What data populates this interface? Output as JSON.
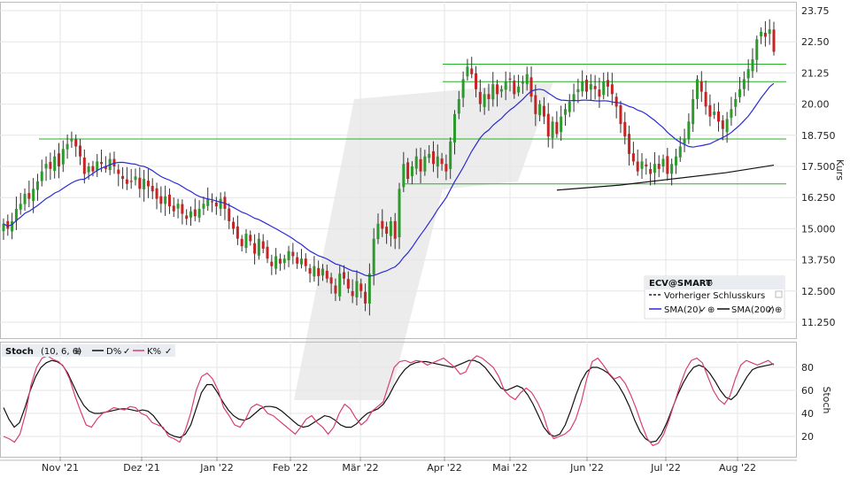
{
  "chart_data": [
    {
      "type": "candlestick",
      "panel": "price",
      "ylabel": "Kurs",
      "ylim": [
        10.5,
        24.0
      ],
      "yticks": [
        "23.75",
        "22.50",
        "21.25",
        "20.00",
        "18.750",
        "17.500",
        "16.250",
        "15.000",
        "13.750",
        "12.500",
        "11.250"
      ],
      "months": [
        "Nov '21",
        "Dez '21",
        "Jan '22",
        "Feb '22",
        "Mär '22",
        "Apr '22",
        "Mai '22",
        "Jun '22",
        "Jul '22",
        "Aug '22"
      ],
      "closes": [
        15.2,
        15.0,
        15.3,
        15.8,
        16.0,
        16.4,
        16.2,
        16.6,
        16.9,
        17.3,
        17.6,
        17.4,
        17.9,
        17.5,
        18.2,
        18.4,
        18.6,
        18.3,
        17.9,
        17.2,
        17.5,
        17.3,
        17.7,
        17.6,
        17.4,
        17.8,
        17.5,
        17.2,
        17.0,
        16.8,
        16.9,
        17.1,
        16.6,
        17.0,
        16.7,
        16.5,
        16.2,
        16.0,
        16.3,
        15.9,
        15.7,
        16.0,
        15.6,
        15.4,
        15.7,
        15.5,
        15.8,
        16.0,
        16.2,
        16.1,
        15.9,
        16.2,
        15.8,
        15.3,
        15.0,
        14.6,
        14.3,
        14.8,
        14.5,
        14.0,
        14.6,
        14.2,
        13.8,
        13.5,
        13.9,
        13.6,
        13.8,
        14.1,
        13.9,
        13.6,
        13.8,
        13.5,
        13.2,
        13.5,
        13.1,
        13.4,
        13.0,
        12.8,
        12.4,
        13.2,
        13.0,
        12.6,
        12.3,
        12.9,
        12.5,
        12.0,
        13.2,
        14.6,
        15.2,
        15.0,
        14.8,
        15.3,
        14.6,
        16.6,
        17.6,
        17.0,
        17.5,
        17.9,
        17.3,
        17.9,
        18.0,
        17.6,
        17.9,
        17.6,
        17.3,
        18.5,
        19.6,
        20.2,
        21.0,
        21.5,
        21.2,
        20.6,
        20.0,
        20.4,
        20.2,
        20.8,
        20.4,
        20.6,
        20.9,
        21.0,
        20.4,
        20.7,
        20.9,
        21.2,
        20.3,
        19.6,
        20.0,
        19.5,
        18.7,
        19.3,
        18.8,
        19.5,
        19.8,
        20.1,
        20.4,
        20.6,
        20.9,
        20.5,
        20.8,
        20.6,
        20.3,
        20.9,
        20.7,
        20.4,
        19.9,
        19.2,
        18.7,
        18.0,
        17.7,
        17.3,
        17.7,
        17.5,
        17.2,
        17.6,
        17.4,
        17.8,
        17.2,
        17.6,
        17.9,
        18.3,
        18.6,
        19.3,
        20.2,
        21.0,
        20.5,
        19.9,
        19.5,
        19.7,
        19.3,
        19.0,
        19.4,
        19.8,
        20.2,
        20.6,
        21.0,
        21.4,
        21.8,
        22.6,
        22.9,
        22.7,
        23.0,
        22.1
      ],
      "series": [
        {
          "name": "SMA(20)",
          "color": "#2b2bd6"
        },
        {
          "name": "SMA(200)",
          "color": "#111111"
        }
      ],
      "horizontal_lines": [
        21.6,
        20.9,
        18.6,
        16.8
      ],
      "hline_color": "#28b028"
    },
    {
      "type": "line",
      "panel": "stochastic",
      "ylabel": "Stoch",
      "ylim": [
        0,
        100
      ],
      "yticks": [
        "80",
        "60",
        "40",
        "20"
      ],
      "params": "(10, 6, 6)",
      "series": [
        {
          "name": "D%",
          "color": "#111111",
          "values": [
            45,
            35,
            28,
            32,
            45,
            60,
            72,
            80,
            84,
            86,
            85,
            82,
            75,
            65,
            55,
            47,
            42,
            40,
            40,
            41,
            42,
            43,
            44,
            44,
            43,
            42,
            43,
            42,
            38,
            32,
            26,
            22,
            20,
            19,
            22,
            30,
            44,
            58,
            65,
            65,
            58,
            50,
            43,
            38,
            35,
            34,
            36,
            40,
            44,
            46,
            46,
            45,
            42,
            38,
            34,
            30,
            28,
            29,
            32,
            35,
            38,
            37,
            34,
            30,
            28,
            28,
            31,
            36,
            40,
            42,
            44,
            48,
            55,
            64,
            72,
            78,
            82,
            84,
            85,
            85,
            84,
            83,
            82,
            81,
            80,
            82,
            84,
            86,
            86,
            84,
            80,
            74,
            68,
            62,
            60,
            62,
            64,
            62,
            56,
            48,
            38,
            28,
            22,
            20,
            22,
            30,
            42,
            56,
            68,
            76,
            80,
            80,
            78,
            75,
            70,
            64,
            56,
            46,
            34,
            24,
            18,
            15,
            16,
            22,
            32,
            44,
            56,
            66,
            74,
            80,
            82,
            80,
            75,
            68,
            60,
            54,
            52,
            56,
            64,
            72,
            78,
            80,
            81,
            82,
            83
          ]
        },
        {
          "name": "K%",
          "color": "#d8406c",
          "values": [
            20,
            18,
            15,
            22,
            40,
            65,
            80,
            88,
            90,
            87,
            85,
            80,
            70,
            55,
            42,
            30,
            28,
            35,
            40,
            42,
            45,
            44,
            43,
            46,
            45,
            40,
            38,
            32,
            30,
            28,
            20,
            18,
            15,
            25,
            40,
            60,
            72,
            75,
            70,
            60,
            45,
            38,
            30,
            28,
            35,
            45,
            48,
            46,
            40,
            38,
            34,
            30,
            26,
            22,
            28,
            35,
            38,
            32,
            28,
            22,
            28,
            40,
            48,
            44,
            36,
            30,
            34,
            42,
            46,
            50,
            65,
            80,
            85,
            86,
            84,
            86,
            85,
            82,
            84,
            86,
            88,
            84,
            80,
            74,
            76,
            86,
            90,
            88,
            84,
            80,
            72,
            60,
            55,
            52,
            58,
            62,
            58,
            50,
            40,
            25,
            18,
            20,
            22,
            26,
            35,
            50,
            70,
            85,
            88,
            82,
            75,
            70,
            72,
            66,
            56,
            44,
            30,
            18,
            12,
            14,
            22,
            35,
            50,
            65,
            78,
            86,
            88,
            84,
            72,
            60,
            52,
            48,
            55,
            70,
            82,
            86,
            84,
            82,
            84,
            86,
            82
          ]
        }
      ]
    }
  ],
  "legend": {
    "symbol": "ECV@SMART",
    "prev_close": "Vorheriger Schlusskurs",
    "sma20": "SMA(20)",
    "sma200": "SMA(200)"
  },
  "stoch_header": {
    "title": "Stoch",
    "params": "(10, 6, 6)",
    "d": "D%",
    "k": "K%"
  },
  "colors": {
    "up": "#2e9a2e",
    "down": "#c62424",
    "grid": "#e6e6e6",
    "watermark": "#ececec"
  }
}
